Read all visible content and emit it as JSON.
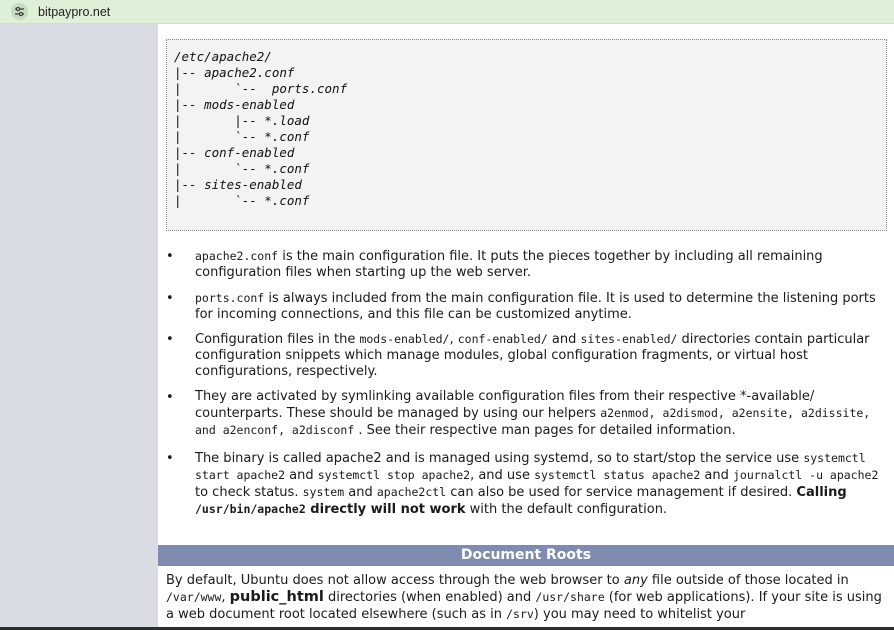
{
  "browser": {
    "url": "bitpaypro.net",
    "site_icon": "tune-icon"
  },
  "code_block": {
    "lines": [
      "/etc/apache2/",
      "|-- apache2.conf",
      "|       `--  ports.conf",
      "|-- mods-enabled",
      "|       |-- *.load",
      "|       `-- *.conf",
      "|-- conf-enabled",
      "|       `-- *.conf",
      "|-- sites-enabled",
      "|       `-- *.conf"
    ]
  },
  "bullets": {
    "b1": {
      "code1": "apache2.conf",
      "t1": " is the main configuration file. It puts the pieces together by including all remaining configuration files when starting up the web server."
    },
    "b2": {
      "code1": "ports.conf",
      "t1": " is always included from the main configuration file. It is used to determine the listening ports for incoming connections, and this file can be customized anytime."
    },
    "b3": {
      "t1": "Configuration files in the ",
      "code1": "mods-enabled/",
      "t2": ", ",
      "code2": "conf-enabled/",
      "t3": " and ",
      "code3": "sites-enabled/",
      "t4": " directories contain particular configuration snippets which manage modules, global configuration fragments, or virtual host configurations, respectively."
    },
    "b4": {
      "t1": "They are activated by symlinking available configuration files from their respective *-available/ counterparts. These should be managed by using our helpers ",
      "code1": "a2enmod, a2dismod, a2ensite, a2dissite, and a2enconf, a2disconf",
      "t2": " . See their respective man pages for detailed information."
    },
    "b5": {
      "t1": "The binary is called apache2 and is managed using systemd, so to start/stop the service use ",
      "code1": "systemctl start apache2",
      "t2": " and ",
      "code2": "systemctl stop apache2",
      "t3": ", and use ",
      "code3": "systemctl status apache2",
      "t4": " and ",
      "code4": "journalctl -u apache2",
      "t5": " to check status. ",
      "code5": "system",
      "t6": " and ",
      "code6": "apache2ctl",
      "t7": " can also be used for service management if desired. ",
      "bold1": "Calling ",
      "boldcode": "/usr/bin/apache2",
      "bold2": " directly will not work",
      "t8": " with the default configuration."
    }
  },
  "section": {
    "title": "Document Roots"
  },
  "paragraph": {
    "t1": "By default, Ubuntu does not allow access through the web browser to ",
    "em1": "any",
    "t2": " file outside of those located in ",
    "code1": "/var/www",
    "t3": ", ",
    "bold1": "public_html",
    "t4": " directories (when enabled) and ",
    "code2": "/usr/share",
    "t5": " (for web applications). If your site is using a web document root located elsewhere (such as in ",
    "code3": "/srv",
    "t6": ") you may need to whitelist your"
  }
}
